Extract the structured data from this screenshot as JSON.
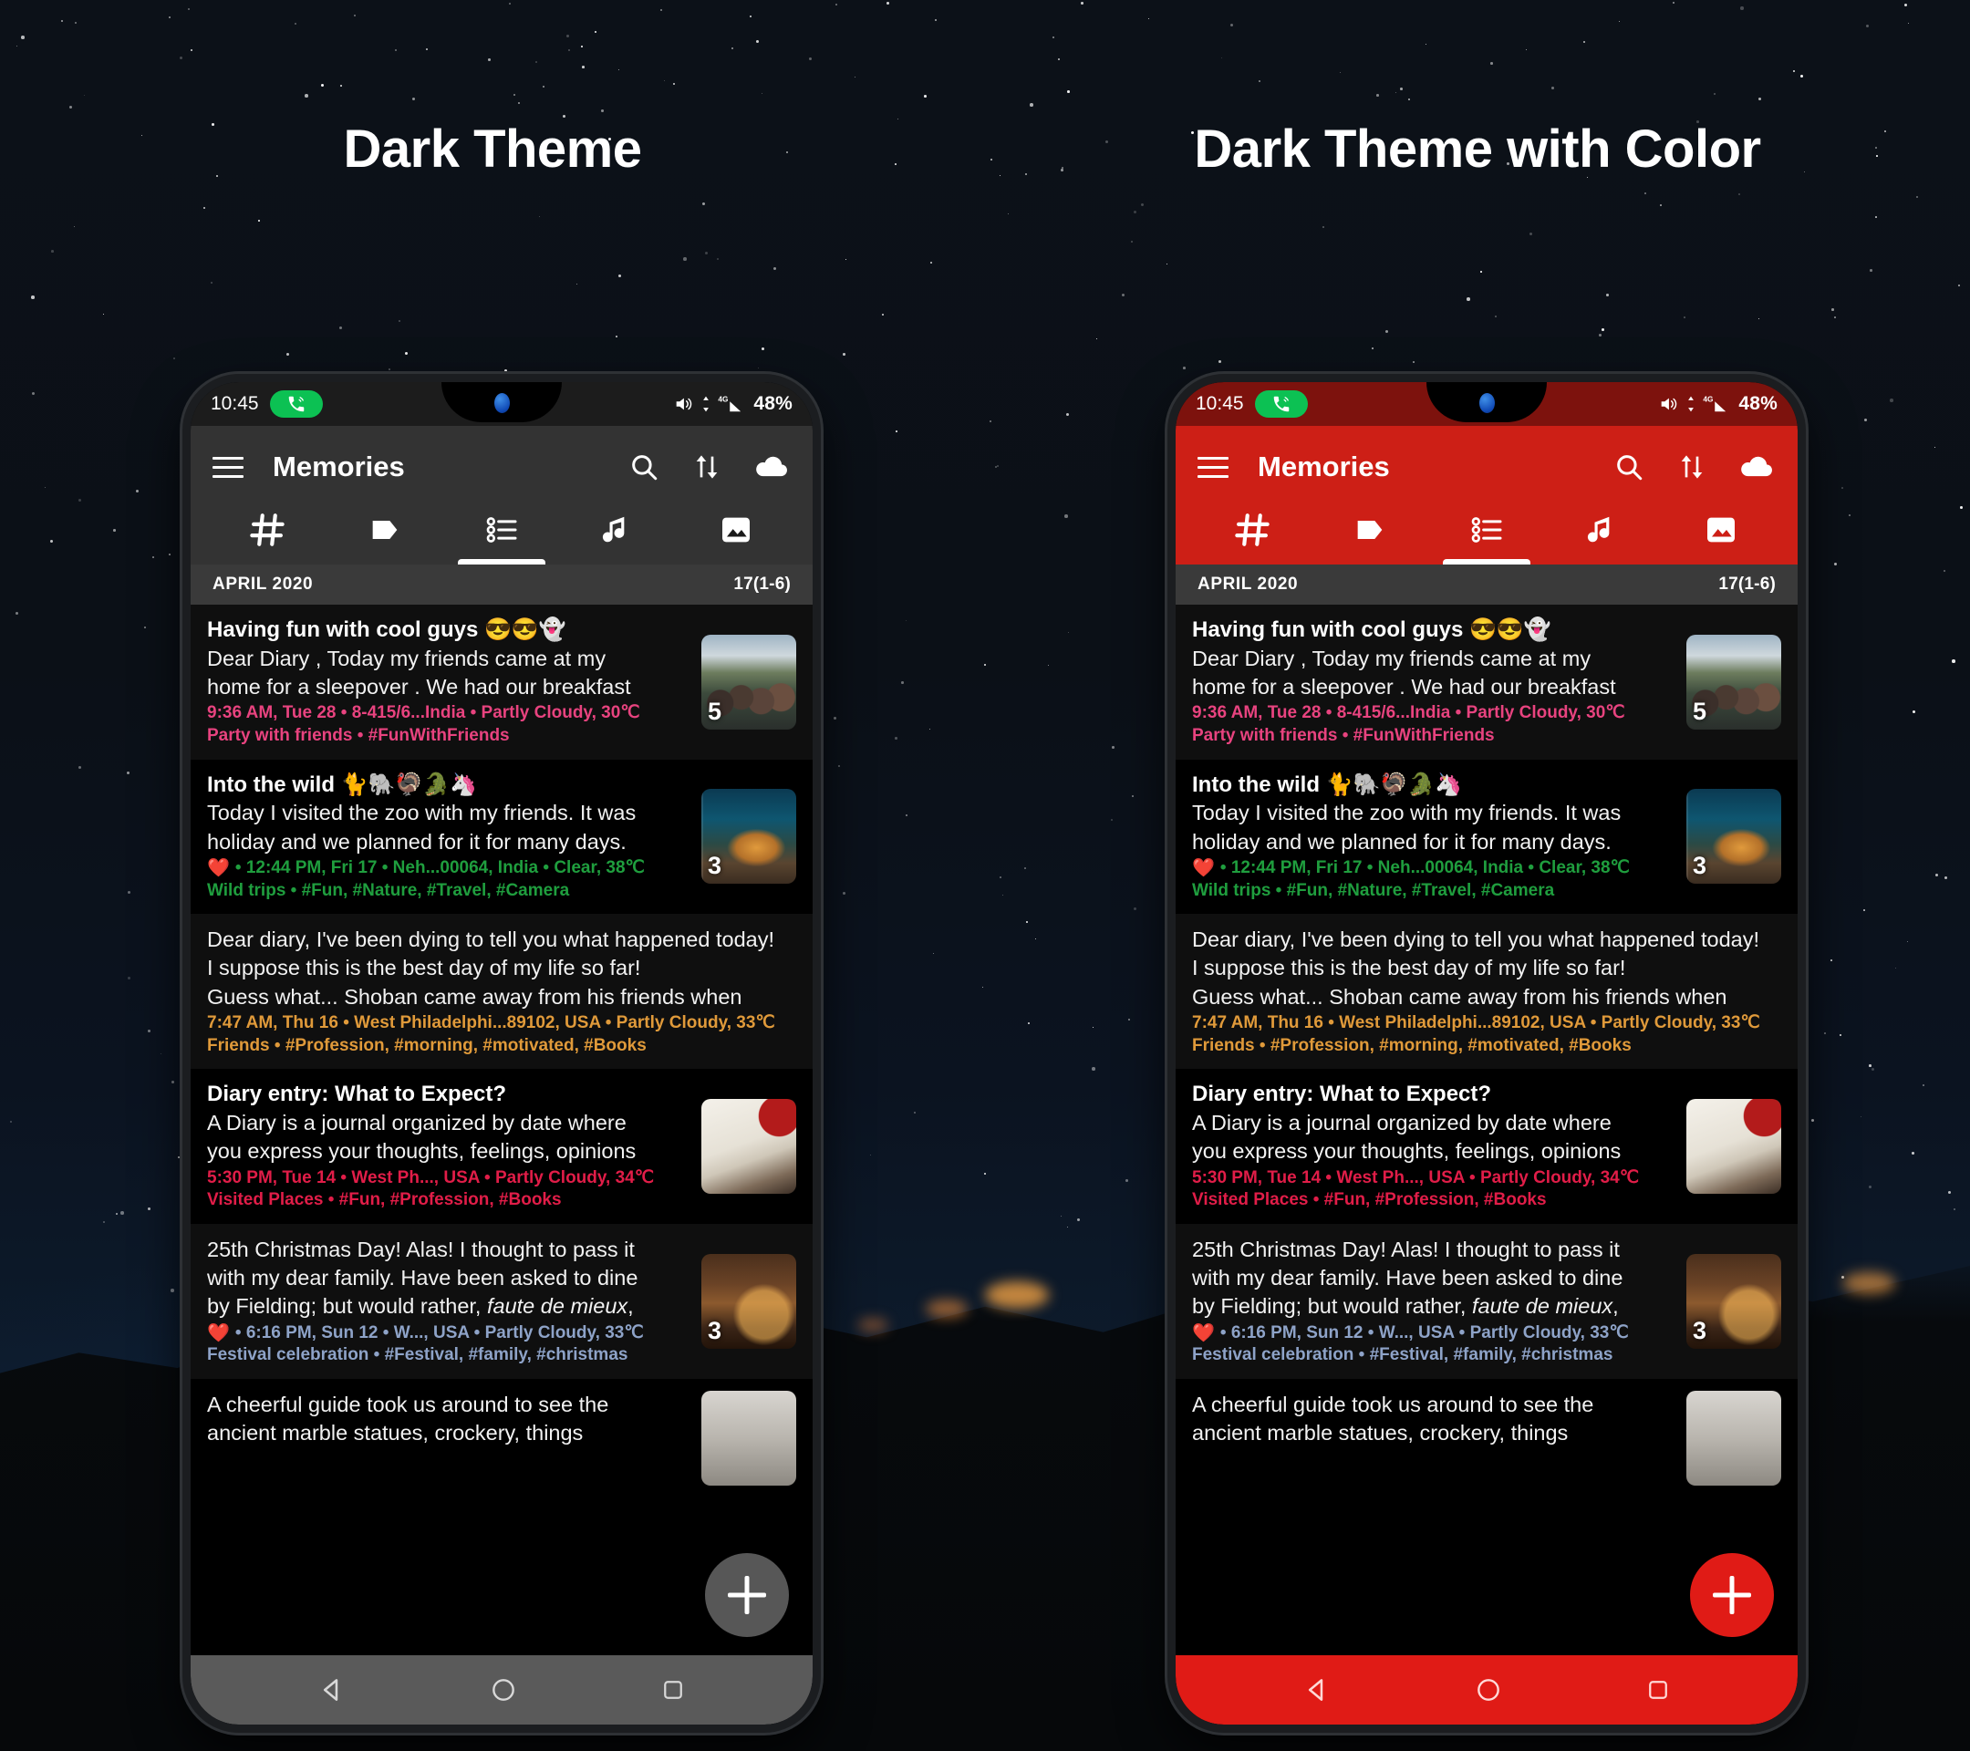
{
  "headings": {
    "left": "Dark Theme",
    "right": "Dark Theme with Color"
  },
  "colors": {
    "dark_appbar": "#333333",
    "dark_statusbar": "#1c1c1c",
    "dark_navbar": "#5a5a5a",
    "dark_fab": "#575757",
    "color_appbar": "#cd1f16",
    "color_statusbar": "#7d120d",
    "color_navbar": "#e01b16",
    "color_fab": "#e01b16",
    "call_pill": "#0cc153",
    "date_header": "#3a3a3a"
  },
  "statusbar": {
    "time": "10:45",
    "battery": "48%",
    "network": "4G",
    "call_icon": "phone-call-icon",
    "volume_icon": "volume-icon",
    "signal_icon": "signal-icon",
    "camera_icon": "front-camera-dot"
  },
  "appbar": {
    "menu_icon": "hamburger-menu-icon",
    "title": "Memories",
    "actions": [
      {
        "name": "search-icon",
        "label": "Search"
      },
      {
        "name": "sort-icon",
        "label": "Sort"
      },
      {
        "name": "cloud-upload-icon",
        "label": "Backup"
      }
    ]
  },
  "tabs": [
    {
      "name": "tab-hashtag",
      "icon": "hashtag-icon",
      "selected": false
    },
    {
      "name": "tab-tag",
      "icon": "tag-icon",
      "selected": false
    },
    {
      "name": "tab-list",
      "icon": "list-icon",
      "selected": true
    },
    {
      "name": "tab-music",
      "icon": "music-note-icon",
      "selected": false
    },
    {
      "name": "tab-photos",
      "icon": "image-icon",
      "selected": false
    }
  ],
  "date_header": {
    "month": "APRIL 2020",
    "count": "17(1-6)"
  },
  "entries": [
    {
      "title": "Having fun with cool guys 😎😎👻",
      "lines": [
        "Dear Diary , Today my friends came at my",
        "home for a sleepover . We had our breakfast"
      ],
      "meta": "9:36 AM, Tue 28 • 8-415/6...India • Partly Cloudy, 30℃",
      "tags": "Party with friends • #FunWithFriends",
      "meta_color": "#e8437f",
      "heart": false,
      "thumb": "t-friends",
      "badge": "5",
      "bg": "alt"
    },
    {
      "title": "Into the wild 🐈🐘🦃🐊🦄",
      "lines": [
        "Today I visited the zoo with my friends. It was",
        "holiday and we planned for it for many days."
      ],
      "meta": "• 12:44 PM, Fri 17 • Neh...00064, India • Clear, 38℃",
      "tags": "Wild trips • #Fun, #Nature, #Travel, #Camera",
      "meta_color": "#1f9e3e",
      "heart": true,
      "thumb": "t-tiger",
      "badge": "3",
      "bg": "plain"
    },
    {
      "title": "",
      "lines": [
        "Dear diary, I've been dying to tell you what happened today!",
        "I suppose this is the best day of my life so far!",
        "Guess what... Shoban came away from his friends when"
      ],
      "meta": "7:47 AM, Thu 16 • West Philadelphi...89102, USA • Partly Cloudy, 33℃",
      "tags": "Friends • #Profession, #morning, #motivated, #Books",
      "meta_color": "#e09a3a",
      "heart": false,
      "thumb": "",
      "badge": "",
      "bg": "alt"
    },
    {
      "title": "Diary entry: What to Expect?",
      "lines": [
        "A Diary is a journal organized by date where",
        "you express your thoughts, feelings, opinions"
      ],
      "meta": "5:30 PM, Tue 14 • West Ph..., USA • Partly Cloudy, 34℃",
      "tags": "Visited Places • #Fun, #Profession, #Books",
      "meta_color": "#e11d48",
      "heart": false,
      "thumb": "t-journal",
      "badge": "",
      "bg": "plain"
    },
    {
      "title": "",
      "lines": [
        "25th Christmas Day! Alas! I thought to pass it",
        "with my dear family. Have been asked to dine",
        "by Fielding; but would rather, faute de mieux,"
      ],
      "meta": "• 6:16 PM, Sun 12 • W..., USA • Partly Cloudy, 33℃",
      "tags": "Festival celebration • #Festival, #family, #christmas",
      "meta_color": "#8ea3c8",
      "heart": true,
      "thumb": "t-xmas",
      "badge": "3",
      "bg": "alt"
    },
    {
      "title": "",
      "lines": [
        "A cheerful guide took us around to see the",
        "ancient marble statues, crockery, things"
      ],
      "meta": "",
      "tags": "",
      "meta_color": "#cccccc",
      "heart": false,
      "thumb": "t-statue",
      "badge": "",
      "bg": "plain"
    }
  ],
  "fab": {
    "icon": "plus-icon",
    "label": "Add entry"
  },
  "navbar": [
    {
      "name": "nav-back-icon",
      "icon": "back-triangle-icon"
    },
    {
      "name": "nav-home-icon",
      "icon": "home-circle-icon"
    },
    {
      "name": "nav-recents-icon",
      "icon": "recents-square-icon"
    }
  ]
}
